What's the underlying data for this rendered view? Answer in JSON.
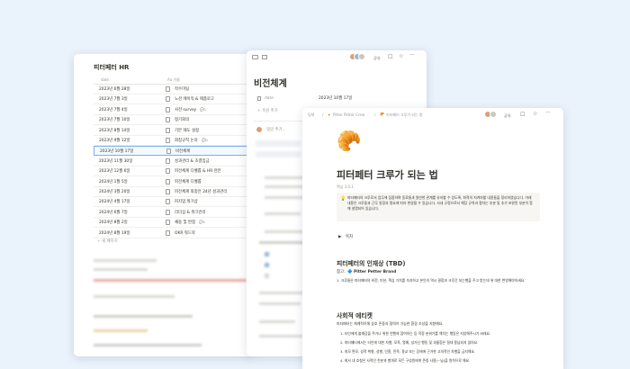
{
  "left_window": {
    "title": "피터페터 HR",
    "col_date": "date",
    "col_name": "Aa 이름",
    "rows": [
      {
        "date": "2023년 6월 28일",
        "name": "작수미팅",
        "comment": ""
      },
      {
        "date": "2023년 7월 3일",
        "name": "노션 에이직 & 제품로고",
        "comment": ""
      },
      {
        "date": "2023년 7월 4일",
        "name": "사전 survey",
        "comment": "1"
      },
      {
        "date": "2023년 7월 10일",
        "name": "정기회의",
        "comment": ""
      },
      {
        "date": "2023년 8월 14일",
        "name": "기본 재도 설정",
        "comment": ""
      },
      {
        "date": "2023년 9월 12일",
        "name": "회칭규칙 논의",
        "comment": "2"
      },
      {
        "date": "2023년 10월 17일",
        "name": "비전체계",
        "comment": ""
      },
      {
        "date": "2023년 11월 30일",
        "name": "성과관리 & 조결임금",
        "comment": ""
      },
      {
        "date": "2023년 12월 6일",
        "name": "피전체계 디벨롭 & HR 현안",
        "comment": ""
      },
      {
        "date": "2024년 1월 5일",
        "name": "피전체계 디벨롭",
        "comment": ""
      },
      {
        "date": "2024년 3월 20일",
        "name": "피전체계 최종안 24년 성과관리",
        "comment": ""
      },
      {
        "date": "2024년 4월 17일",
        "name": "피지업 워크샵",
        "comment": ""
      },
      {
        "date": "2024년 6월 7일",
        "name": "리더십 & 워크관리",
        "comment": ""
      },
      {
        "date": "2024년 8월 2일",
        "name": "채용 및 면접",
        "comment": "2"
      },
      {
        "date": "2024년 8월 19일",
        "name": "OKR 워드북",
        "comment": ""
      }
    ],
    "new_page": "+ 새 페이지"
  },
  "middle_window": {
    "share_label": "공유",
    "page_title": "비전체계",
    "prop_date_label": "date",
    "prop_date_value": "2023년 10월 17일",
    "add_property": "+ 속성 추가",
    "comment_placeholder": "댓글 추가..."
  },
  "right_window": {
    "breadcrumb": [
      "팀체",
      "Pitter Petter Crew",
      "피터페터 크루가 되는 법"
    ],
    "edit_label": "편집 1분 전",
    "share_label": "공유",
    "page_emoji": "🥐",
    "page_title": "피터페터 크루가 되는 법",
    "sub_label": "핵심 3.0.1",
    "callout_text": "피터페터의 크루로서 업무에 집중하며 동료들과 원만한 관계를 유지할 수 있도록, 최적의 지켜야할 내용들을 정리하였습니다. 아래 내용은 크루들과 근무 일정과 필요에 따라 변경될 수 있습니다. 사내 규정으로서 해당 규칙과 절차는 부분 및 추가 보완된 부분이 함께 설명되어 있습니다.",
    "toggle_label": "목차",
    "section1_title": "피터페터의 인재상 (TBD)",
    "section1_ref_prefix": "참고:",
    "section1_ref": "Pitter Petter Brand",
    "section1_items": [
      "1. 크루들은 피터페터의 비전, 미션, 핵심 가치를 숙지하고 본인의 역시 결정과 크루간 되는행을 주고 받는데 위 대한 변영해야하세요."
    ],
    "section2_title": "사회적 에티켓",
    "section2_intro": "피터페터는 체계적이해 상호 존중과 협력이 가능한 환경 조성을 지향해요.",
    "section2_items": [
      "1. 타인에게 불쾌감을 주거나 위한 언행에 참여하는 등 적정 분위기를 해치는 행동은 지양해주시기 바래요.",
      "2. 피터페터에서는 타인에 대한 차별, 모욕, 명예, 성가신 행동 및 괴롭힘은 절대 용납되지 않아요.",
      "3. 외모 면모, 성적 취향, 성별, 인종, 민족, 종교 또는 장애에 근거한 고의적인 차별을 금지해요.",
      "4. 회사 내 호칭은 사적인 친분과 별개로 모든 구성원에게 존칭 사용(~님)을 원칙으로 해요."
    ]
  },
  "colors": {
    "background": "#eaf2fb",
    "callout_bg": "#f7f6f3",
    "accent_blue": "#2f80d1"
  }
}
